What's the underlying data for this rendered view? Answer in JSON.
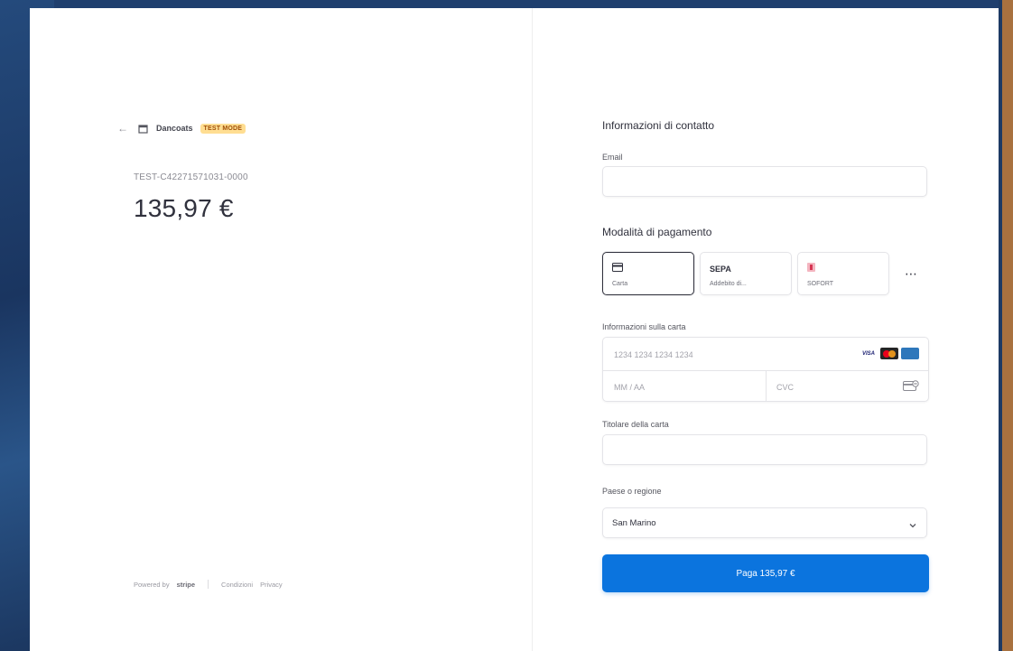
{
  "colors": {
    "accent": "#0b74de",
    "badge_bg": "#ffde92",
    "badge_text": "#a04f08"
  },
  "left": {
    "merchant_name": "Dancoats",
    "test_badge": "TEST MODE",
    "invoice_id": "TEST-C42271571031-0000",
    "amount": "135,97 €",
    "footer": {
      "powered_by": "Powered by",
      "brand": "stripe",
      "terms": "Condizioni",
      "privacy": "Privacy"
    }
  },
  "contact": {
    "title": "Informazioni di contatto",
    "email_label": "Email",
    "email_value": ""
  },
  "payment": {
    "title": "Modalità di pagamento",
    "methods": [
      {
        "icon": "credit-card-icon",
        "label": "Carta"
      },
      {
        "icon": "sepa-icon",
        "title": "SEPA",
        "label": "Addebito di..."
      },
      {
        "icon": "sofort-icon",
        "label": "SOFORT"
      }
    ],
    "more": "⋯"
  },
  "card": {
    "label": "Informazioni sulla carta",
    "number_placeholder": "1234 1234 1234 1234",
    "expiry_placeholder": "MM / AA",
    "cvc_placeholder": "CVC",
    "brands": [
      "VISA",
      "mastercard-icon",
      "amex-icon"
    ]
  },
  "cardholder": {
    "label": "Titolare della carta",
    "value": ""
  },
  "country": {
    "label": "Paese o regione",
    "value": "San Marino"
  },
  "pay_button": "Paga 135,97 €"
}
